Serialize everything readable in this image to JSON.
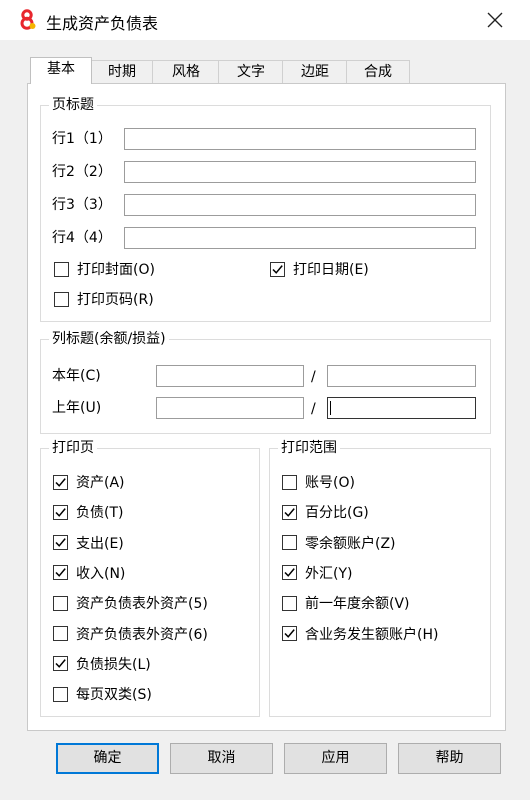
{
  "window": {
    "title": "生成资产负债表",
    "app_icon": "app-8-icon",
    "close_glyph": "✕"
  },
  "tabs": [
    {
      "label": "基本",
      "active": true
    },
    {
      "label": "时期",
      "active": false
    },
    {
      "label": "风格",
      "active": false
    },
    {
      "label": "文字",
      "active": false
    },
    {
      "label": "边距",
      "active": false
    },
    {
      "label": "合成",
      "active": false
    }
  ],
  "page_title_group": {
    "title": "页标题",
    "lines": [
      {
        "label": "行1（1）",
        "value": ""
      },
      {
        "label": "行2（2）",
        "value": ""
      },
      {
        "label": "行3（3）",
        "value": ""
      },
      {
        "label": "行4（4）",
        "value": ""
      }
    ],
    "print_cover": {
      "label": "打印封面(O)",
      "checked": false
    },
    "print_date": {
      "label": "打印日期(E)",
      "checked": true
    },
    "print_page_number": {
      "label": "打印页码(R)",
      "checked": false
    }
  },
  "column_title_group": {
    "title": "列标题(余额/损益)",
    "this_year": {
      "label": "本年(C)",
      "left": "",
      "right": "",
      "separator": "/"
    },
    "last_year": {
      "label": "上年(U)",
      "left": "",
      "right": "",
      "separator": "/"
    }
  },
  "print_pages_group": {
    "title": "打印页",
    "items": [
      {
        "label": "资产(A)",
        "checked": true
      },
      {
        "label": "负债(T)",
        "checked": true
      },
      {
        "label": "支出(E)",
        "checked": true
      },
      {
        "label": "收入(N)",
        "checked": true
      },
      {
        "label": "资产负债表外资产(5)",
        "checked": false
      },
      {
        "label": "资产负债表外资产(6)",
        "checked": false
      },
      {
        "label": "负债损失(L)",
        "checked": true
      },
      {
        "label": "每页双类(S)",
        "checked": false
      }
    ]
  },
  "print_range_group": {
    "title": "打印范围",
    "items": [
      {
        "label": "账号(O)",
        "checked": false
      },
      {
        "label": "百分比(G)",
        "checked": true
      },
      {
        "label": "零余额账户(Z)",
        "checked": false
      },
      {
        "label": "外汇(Y)",
        "checked": true
      },
      {
        "label": "前一年度余额(V)",
        "checked": false
      },
      {
        "label": "含业务发生额账户(H)",
        "checked": true
      }
    ]
  },
  "buttons": {
    "ok": "确定",
    "cancel": "取消",
    "apply": "应用",
    "help": "帮助"
  },
  "colors": {
    "accent": "#0078d7",
    "icon_red": "#e8262d"
  }
}
